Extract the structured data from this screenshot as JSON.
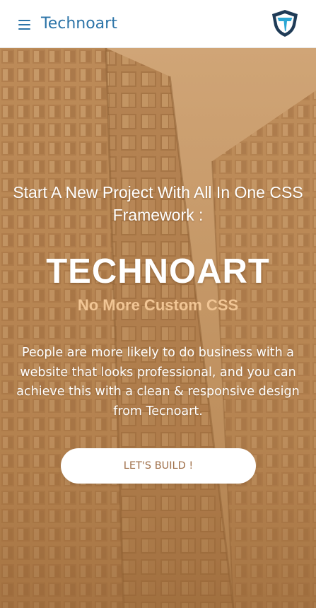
{
  "header": {
    "menu_icon": "hamburger-menu-icon",
    "brand": "Technoart",
    "logo_icon": "shield-logo-icon"
  },
  "hero": {
    "title": "Start A New Project With All In One CSS Framework :",
    "brand_big": "TECHNOART",
    "tagline": "No More Custom CSS",
    "description": "People are more likely to do business with a website that looks professional, and you can achieve this with a clean & responsive design from Tecnoart.",
    "cta_label": "LET'S BUILD !",
    "background": "building-facade-photo"
  },
  "colors": {
    "brand_blue": "#2c74a8",
    "hero_tint": "#b98a57",
    "tagline": "#f1c594",
    "cta_text": "#a0704a",
    "logo_dark": "#1f3b57",
    "logo_blue": "#2aa6d4"
  }
}
